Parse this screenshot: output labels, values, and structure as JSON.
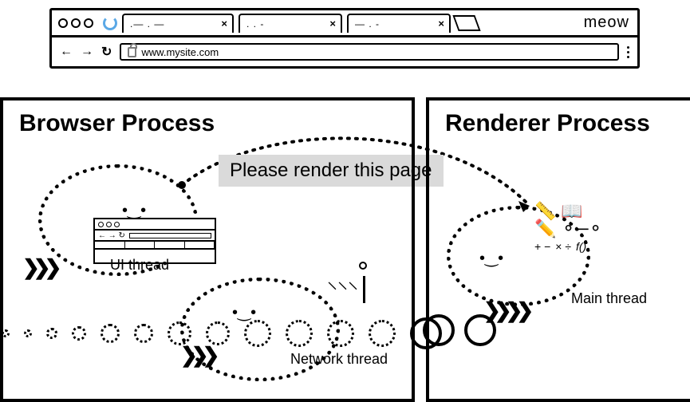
{
  "chrome": {
    "tabs": [
      {
        "label": ".— . —",
        "closable": true
      },
      {
        "label": ". . -",
        "closable": true
      },
      {
        "label": "— . -",
        "closable": true
      }
    ],
    "brand": "meow",
    "url": "www.mysite.com",
    "nav": {
      "back": "←",
      "fwd": "→",
      "reload": "↻"
    }
  },
  "panes": {
    "left_title": "Browser Process",
    "right_title": "Renderer Process"
  },
  "threads": {
    "ui": "UI thread",
    "network": "Network thread",
    "main": "Main thread"
  },
  "message": "Please render this page",
  "tools": {
    "ruler": "📏",
    "book": "📖",
    "pencil": "✏️",
    "math1": "+ −",
    "math2": "× ÷",
    "fn": "f()"
  }
}
